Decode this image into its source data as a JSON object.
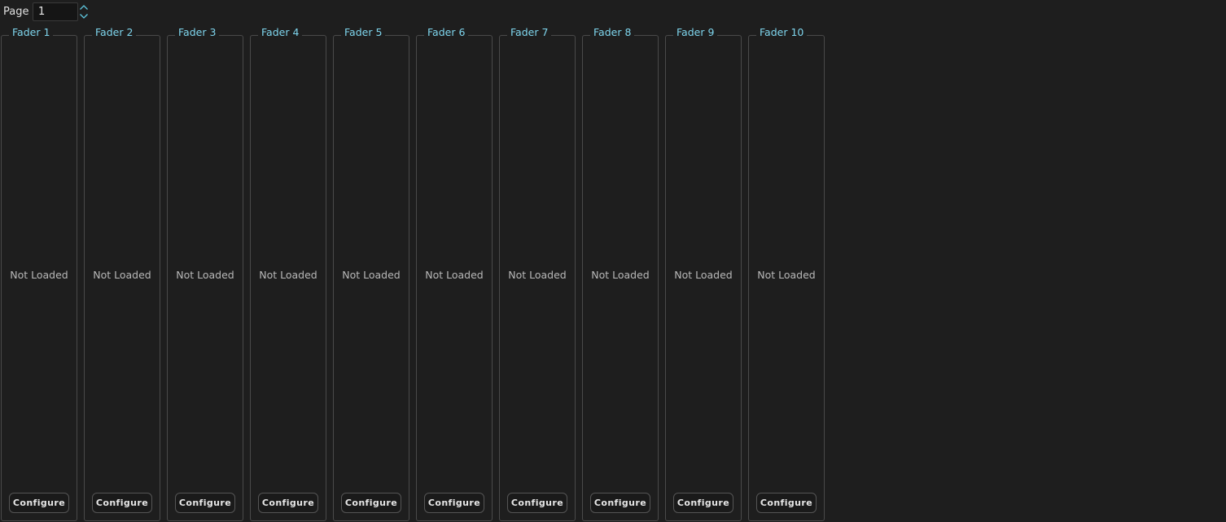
{
  "page_control": {
    "label": "Page",
    "value": "1",
    "arrow_up_icon": "chevron-up-icon",
    "arrow_down_icon": "chevron-down-icon",
    "accent_color": "#5fc8e0"
  },
  "faders": [
    {
      "title": "Fader 1",
      "status": "Not Loaded",
      "button": "Configure"
    },
    {
      "title": "Fader 2",
      "status": "Not Loaded",
      "button": "Configure"
    },
    {
      "title": "Fader 3",
      "status": "Not Loaded",
      "button": "Configure"
    },
    {
      "title": "Fader 4",
      "status": "Not Loaded",
      "button": "Configure"
    },
    {
      "title": "Fader 5",
      "status": "Not Loaded",
      "button": "Configure"
    },
    {
      "title": "Fader 6",
      "status": "Not Loaded",
      "button": "Configure"
    },
    {
      "title": "Fader 7",
      "status": "Not Loaded",
      "button": "Configure"
    },
    {
      "title": "Fader 8",
      "status": "Not Loaded",
      "button": "Configure"
    },
    {
      "title": "Fader 9",
      "status": "Not Loaded",
      "button": "Configure"
    },
    {
      "title": "Fader 10",
      "status": "Not Loaded",
      "button": "Configure"
    }
  ],
  "colors": {
    "background": "#1e1e1e",
    "title_color": "#7fd6ee",
    "status_color": "#b8b8b8",
    "border": "#4a4a4a"
  }
}
